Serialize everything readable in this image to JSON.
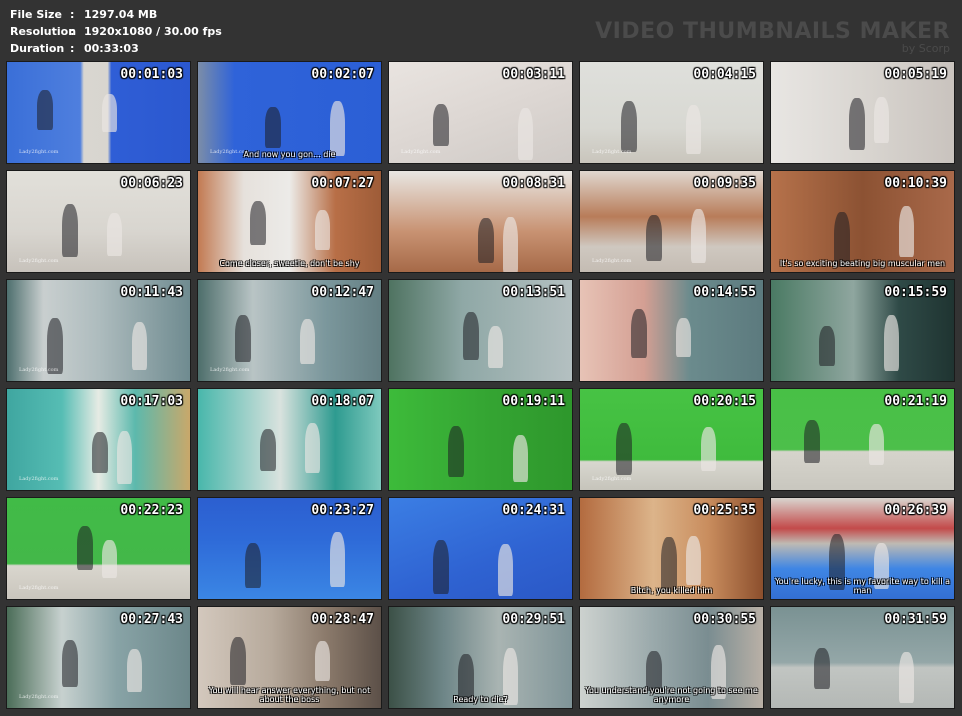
{
  "header": {
    "rows": [
      {
        "label": "File Size",
        "sep": ":",
        "value": "1297.04 MB"
      },
      {
        "label": "Resolution",
        "sep": ":",
        "value": "1920x1080 / 30.00 fps"
      },
      {
        "label": "Duration",
        "sep": ":",
        "value": "00:33:03"
      }
    ]
  },
  "brand": {
    "title": "VIDEO THUMBNAILS MAKER",
    "subtitle": "by Scorp"
  },
  "thumbs": [
    {
      "time": "00:01:03",
      "wm": "Lady2fight.com",
      "caption": "",
      "bg": "linear-gradient(90deg,#3a6fd8 0%,#4f7fde 40%,#d9d6d0 42%,#d8d5cf 55%,#2f5ed6 57%,#2b58cf 100%)"
    },
    {
      "time": "00:02:07",
      "wm": "Lady2fight.com",
      "caption": "And now you gon... die",
      "bg": "linear-gradient(90deg,#7b8da8 0%,#2f63d9 20%,#2b5fd6 100%)"
    },
    {
      "time": "00:03:11",
      "wm": "Lady2fight.com",
      "caption": "",
      "bg": "linear-gradient(160deg,#e9e4e0 0%,#ddd7d3 50%,#cfcac6 100%)"
    },
    {
      "time": "00:04:15",
      "wm": "Lady2fight.com",
      "caption": "",
      "bg": "linear-gradient(180deg,#dfe0dc 0%,#d8d8d2 65%,#c9c5bc 100%)"
    },
    {
      "time": "00:05:19",
      "wm": "",
      "caption": "",
      "bg": "linear-gradient(90deg,#e8e6e3 0%,#d6d2cd 60%,#c9c3be 100%)"
    },
    {
      "time": "00:06:23",
      "wm": "Lady2fight.com",
      "caption": "",
      "bg": "linear-gradient(180deg,#e2e0da 0%,#d8d5cf 60%,#c7c2bb 100%)"
    },
    {
      "time": "00:07:27",
      "wm": "",
      "caption": "Come closer, sweetie, don't be shy",
      "bg": "linear-gradient(90deg,#c27a52 0%,#e6e1dc 25%,#ecebe8 50%,#b86f47 75%,#9e5c38 100%)"
    },
    {
      "time": "00:08:31",
      "wm": "",
      "caption": "",
      "bg": "linear-gradient(180deg,#e8e6e2 0%,#c89272 60%,#a66a48 100%)"
    },
    {
      "time": "00:09:35",
      "wm": "Lady2fight.com",
      "caption": "",
      "bg": "linear-gradient(180deg,#e0d7cf 0%,#b87c59 45%,#cfc8c0 75%,#c4bcb3 100%)"
    },
    {
      "time": "00:10:39",
      "wm": "",
      "caption": "It's so exciting beating big muscular men",
      "bg": "linear-gradient(90deg,#b6724b 0%,#8c5233 50%,#a9694a 100%)"
    },
    {
      "time": "00:11:43",
      "wm": "Lady2fight.com",
      "caption": "",
      "bg": "linear-gradient(90deg,#4e6f6e 0%,#c9cfcf 20%,#aebcbe 50%,#6f8b90 100%)"
    },
    {
      "time": "00:12:47",
      "wm": "Lady2fight.com",
      "caption": "",
      "bg": "linear-gradient(90deg,#4d6e6b 0%,#b9c4c5 30%,#7b979c 70%,#647f83 100%)"
    },
    {
      "time": "00:13:51",
      "wm": "",
      "caption": "",
      "bg": "linear-gradient(90deg,#4f7361 0%,#8fa8a6 40%,#b4c0c1 100%)"
    },
    {
      "time": "00:14:55",
      "wm": "",
      "caption": "",
      "bg": "linear-gradient(90deg,#e7c3b6 0%,#d49f93 35%,#6b8b8d 60%,#5c7a7e 100%)"
    },
    {
      "time": "00:15:59",
      "wm": "",
      "caption": "",
      "bg": "linear-gradient(90deg,#4a7a63 0%,#8fa69f 45%,#2f4a47 70%,#1f3431 100%)"
    },
    {
      "time": "00:17:03",
      "wm": "Lady2fight.com",
      "caption": "",
      "bg": "linear-gradient(90deg,#3fa6a0 0%,#56bdb4 30%,#e6ebe4 50%,#5cb9ad 70%,#c9a86a 100%)"
    },
    {
      "time": "00:18:07",
      "wm": "",
      "caption": "",
      "bg": "linear-gradient(90deg,#48b7ab 0%,#d9e2de 45%,#2e9b90 75%,#7ec9bd 100%)"
    },
    {
      "time": "00:19:11",
      "wm": "",
      "caption": "",
      "bg": "linear-gradient(90deg,#3dbb3a 0%,#35a633 50%,#2e972c 100%)"
    },
    {
      "time": "00:20:15",
      "wm": "Lady2fight.com",
      "caption": "",
      "bg": "linear-gradient(180deg,#47c344 0%,#3fbb3d 70%,#d8d7cf 72%,#c6c4bb 100%)"
    },
    {
      "time": "00:21:19",
      "wm": "",
      "caption": "",
      "bg": "linear-gradient(180deg,#48c046 0%,#4cbf4a 60%,#d6d4cc 62%,#c9c7bf 100%)"
    },
    {
      "time": "00:22:23",
      "wm": "Lady2fight.com",
      "caption": "",
      "bg": "linear-gradient(180deg,#41bb47 0%,#43b849 65%,#d9d6ce 67%,#cac6bd 100%)"
    },
    {
      "time": "00:23:27",
      "wm": "",
      "caption": "",
      "bg": "linear-gradient(180deg,#2c5fd0 0%,#2e6ad8 40%,#3b86e4 100%)"
    },
    {
      "time": "00:24:31",
      "wm": "",
      "caption": "",
      "bg": "linear-gradient(160deg,#3b7ee4 0%,#2f63d2 60%,#2b58c6 100%)"
    },
    {
      "time": "00:25:35",
      "wm": "",
      "caption": "Bitch, you killed him",
      "bg": "linear-gradient(90deg,#b36b3f 0%,#dcb48a 40%,#c98d5e 70%,#8c4f2d 100%)"
    },
    {
      "time": "00:26:39",
      "wm": "",
      "caption": "You're lucky, this is my favorite way to kill a man",
      "bg": "linear-gradient(180deg,#d9d5cf 0%,#c34a4a 30%,#bfbab3 45%,#3f86e4 70%,#336fd3 100%)"
    },
    {
      "time": "00:27:43",
      "wm": "Lady2fight.com",
      "caption": "",
      "bg": "linear-gradient(90deg,#4b6d58 0%,#c7d1cf 30%,#88a3a6 60%,#6c878a 100%)"
    },
    {
      "time": "00:28:47",
      "wm": "",
      "caption": "You will hear answer everything, but not about the boss",
      "bg": "linear-gradient(90deg,#d3c8bd 0%,#b7aa9c 40%,#8b7a6b 70%,#5c5048 100%)"
    },
    {
      "time": "00:29:51",
      "wm": "",
      "caption": "Ready to die?",
      "bg": "linear-gradient(90deg,#3c5147 0%,#6e8688 30%,#a9b4b2 60%,#7f9498 100%)"
    },
    {
      "time": "00:30:55",
      "wm": "",
      "caption": "You understand you're not going to see me anymore",
      "bg": "linear-gradient(90deg,#cdd2cf 0%,#9aa9ab 40%,#7a8d91 70%,#b9b0a6 100%)"
    },
    {
      "time": "00:31:59",
      "wm": "",
      "caption": "",
      "bg": "linear-gradient(180deg,#7a9293 0%,#94a7a8 55%,#c1c5c2 60%,#b4b8b5 100%)"
    }
  ]
}
